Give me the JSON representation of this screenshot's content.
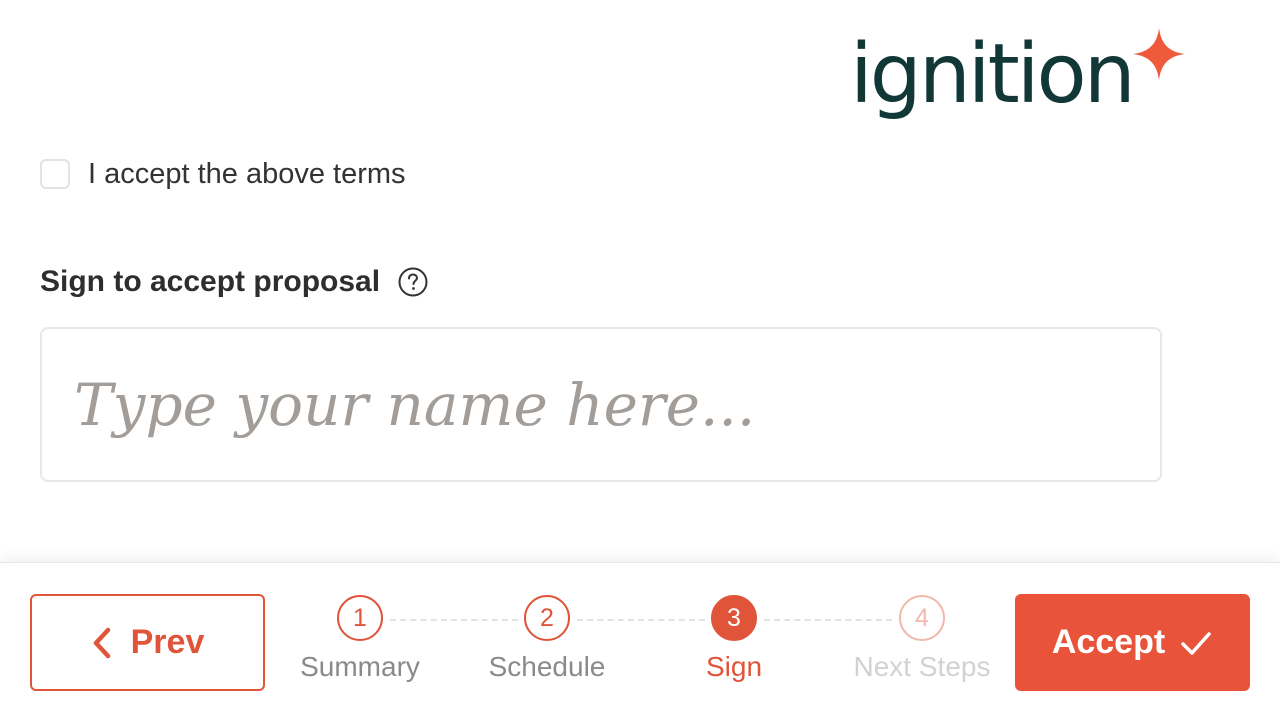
{
  "brand": {
    "logo_text": "ignition",
    "accent_color": "#e8533a",
    "logo_color": "#113737"
  },
  "terms": {
    "checked": false,
    "label": "I accept the above terms"
  },
  "signature": {
    "heading": "Sign to accept proposal",
    "help_icon": "question-circle-icon",
    "placeholder": "Type your name here...",
    "value": ""
  },
  "footer": {
    "prev_label": "Prev",
    "accept_label": "Accept",
    "steps": [
      {
        "number": "1",
        "label": "Summary",
        "state": "done"
      },
      {
        "number": "2",
        "label": "Schedule",
        "state": "done"
      },
      {
        "number": "3",
        "label": "Sign",
        "state": "active"
      },
      {
        "number": "4",
        "label": "Next Steps",
        "state": "upcoming"
      }
    ]
  }
}
